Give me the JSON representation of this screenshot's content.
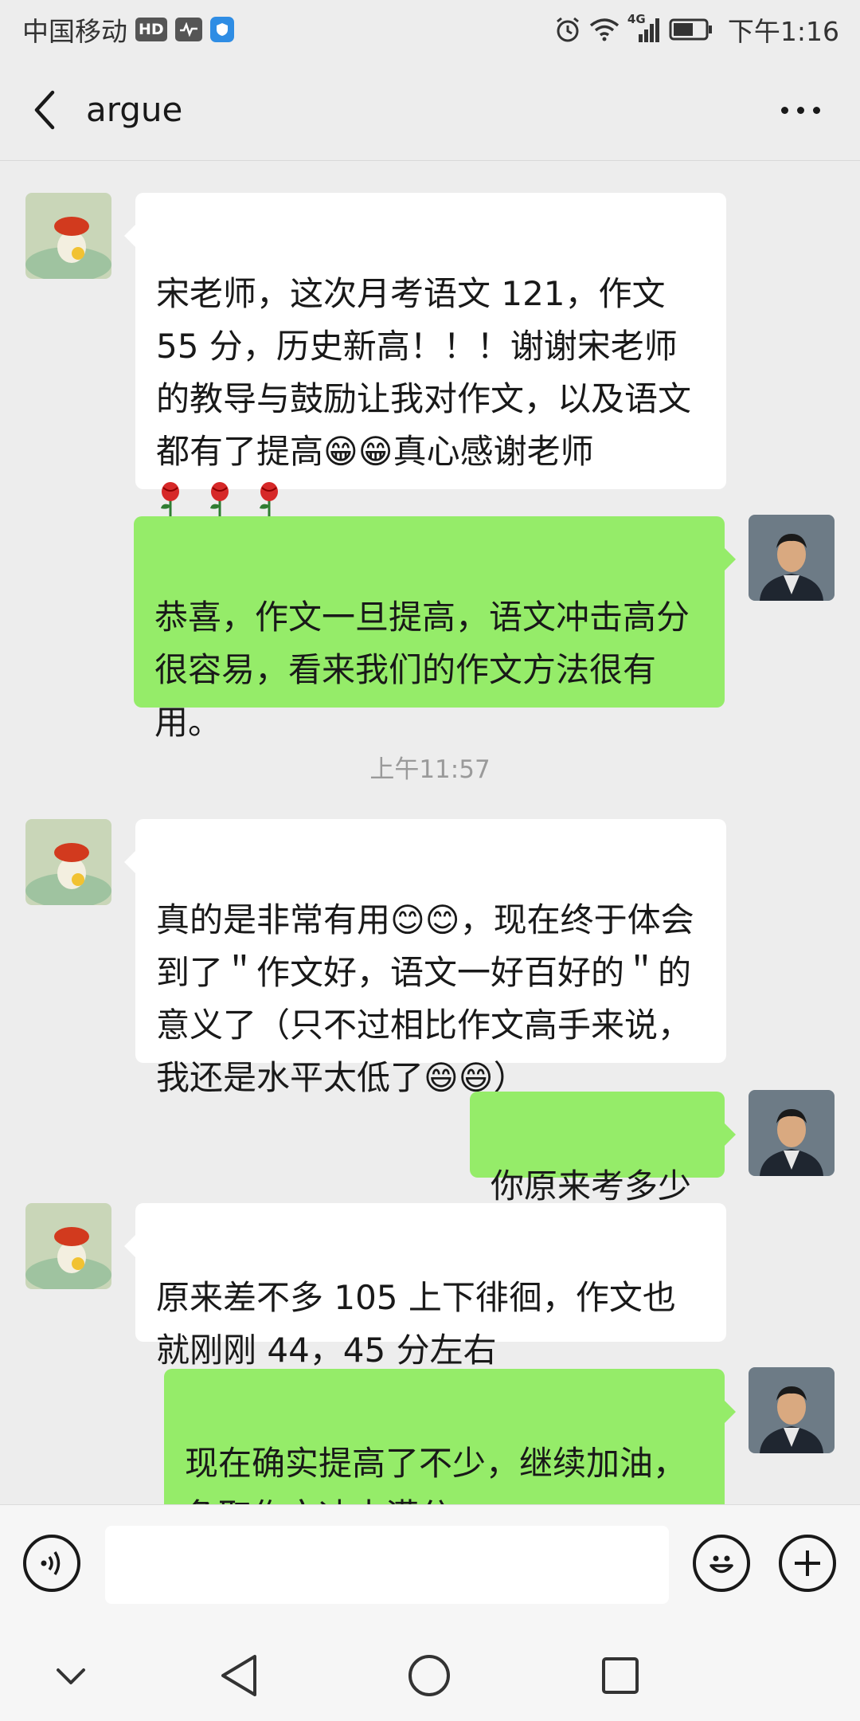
{
  "status_bar": {
    "carrier": "中国移动",
    "hd_badge": "HD",
    "network_badge": "4G",
    "time": "下午1:16"
  },
  "header": {
    "title": "argue"
  },
  "messages": [
    {
      "side": "in",
      "text": "宋老师，这次月考语文 121，作文 55 分，历史新高！！！谢谢宋老师的教导与鼓励让我对作文，以及语文都有了提高😁😁真心感谢老师"
    },
    {
      "side": "out",
      "text": "恭喜，作文一旦提高，语文冲击高分很容易，看来我们的作文方法很有用。"
    },
    {
      "side": "in",
      "text": "真的是非常有用😊😊，现在终于体会到了＂作文好，语文一好百好的＂的意义了（只不过相比作文高手来说，我还是水平太低了😄😄）"
    },
    {
      "side": "out",
      "text": "你原来考多少"
    },
    {
      "side": "in",
      "text": "原来差不多 105 上下徘徊，作文也就刚刚 44，45 分左右"
    },
    {
      "side": "out",
      "text": "现在确实提高了不少，继续加油，争取作文冲击满分"
    }
  ],
  "timestamp": "上午11:57",
  "input": {
    "value": "",
    "placeholder": ""
  },
  "colors": {
    "background": "#ededed",
    "incoming_bubble": "#ffffff",
    "outgoing_bubble": "#95ec69",
    "timestamp_text": "#9a9a9a"
  },
  "icons": [
    "back-arrow-icon",
    "more-dots-icon",
    "voice-icon",
    "emoji-icon",
    "plus-icon",
    "nav-down-icon",
    "nav-back-icon",
    "nav-home-icon",
    "nav-recent-icon",
    "rose-icon"
  ]
}
